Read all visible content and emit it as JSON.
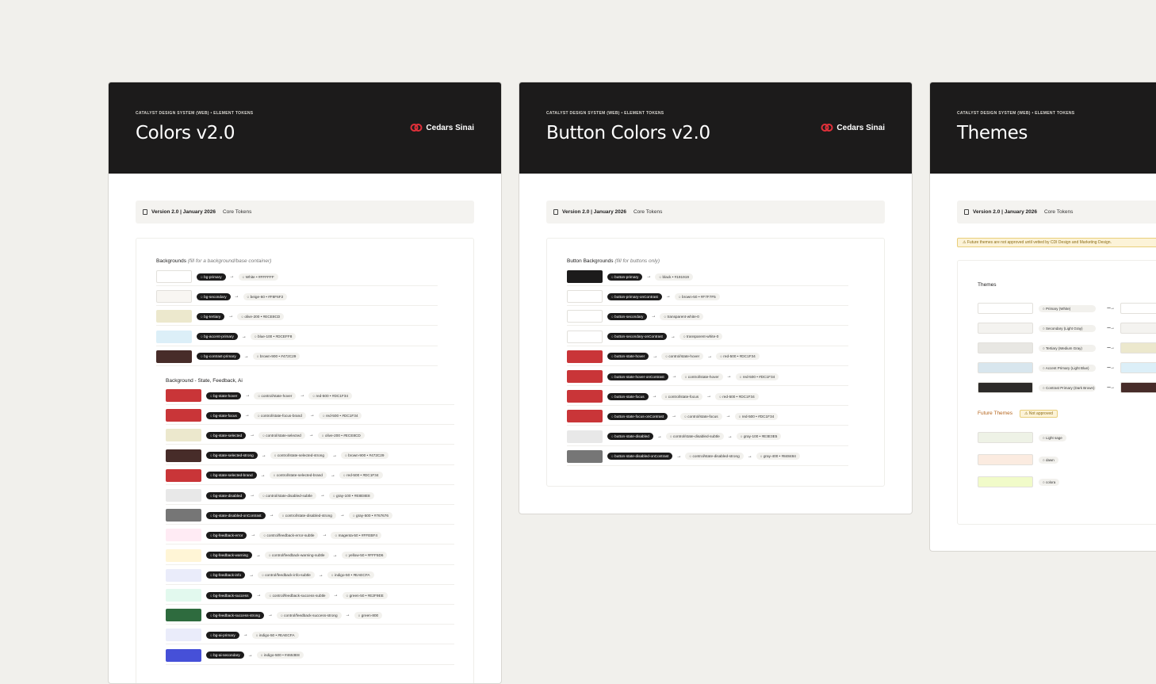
{
  "common": {
    "breadcrumb": "CATALYST DESIGN SYSTEM (WEB) • ELEMENT TOKENS",
    "logo_text": "Cedars Sinai",
    "version": "Version 2.0 | January 2026",
    "core_tokens": "Core Tokens",
    "arrow": "→"
  },
  "colors": {
    "title": "Colors v2.0",
    "backgrounds_title": "Backgrounds",
    "backgrounds_hint": "(fill for a background/base container)",
    "backgrounds": [
      {
        "swatch": "#FFFFFF",
        "token": "○ bg-primary",
        "value": "○ White • #FFFFFF"
      },
      {
        "swatch": "#F8F6F2",
        "token": "○ bg-secondary",
        "value": "○ beige-60 • #F8F6F2"
      },
      {
        "swatch": "#ECE8CD",
        "token": "○ bg-tertiary",
        "value": "○ olive-200 • #ECE8CD"
      },
      {
        "swatch": "#DCEFF8",
        "token": "○ bg-accent-primary",
        "value": "○ blue-100 • #DCEFF8"
      },
      {
        "swatch": "#472C29",
        "token": "○ bg-contrast-primary",
        "value": "○ brown-900 • #472C29"
      }
    ],
    "state_title": "Background - State, Feedback, Ai",
    "state": [
      {
        "swatch": "#C93538",
        "token": "○ bg-state-hover",
        "mid": "○ control/state-hover",
        "value": "○ red-500 • #DC1F34"
      },
      {
        "swatch": "#C93538",
        "token": "○ bg-state-focus",
        "mid": "○ control/state-focus-brand",
        "value": "○ red-500 • #DC1F34"
      },
      {
        "swatch": "#ECE8CD",
        "token": "○ bg-state-selected",
        "mid": "○ control/state-selected",
        "value": "○ olive-200 • #ECE8CD"
      },
      {
        "swatch": "#472C29",
        "token": "○ bg-state-selected-strong",
        "mid": "○ control/state-selected-strong",
        "value": "○ brown-900 • #472C29"
      },
      {
        "swatch": "#C93538",
        "token": "○ bg-state-selected-brand",
        "mid": "○ control/state-selected-brand",
        "value": "○ red-500 • #DC1F34"
      },
      {
        "swatch": "#E8E8E8",
        "token": "○ bg-state-disabled",
        "mid": "○ control/state-disabled-subtle",
        "value": "○ gray-100 • #E8E8E8"
      },
      {
        "swatch": "#767676",
        "token": "○ bg-state-disabled-onContrast",
        "mid": "○ control/state-disabled-strong",
        "value": "○ gray-500 • #767676"
      },
      {
        "swatch": "#FFEBF4",
        "token": "○ bg-feedback-error",
        "mid": "○ control/feedback-error-subtle",
        "value": "○ magenta-50 • #FFEBF4"
      },
      {
        "swatch": "#FFF5D6",
        "token": "○ bg-feedback-warning",
        "mid": "○ control/feedback-warning-subtle",
        "value": "○ yellow-50 • #FFF5D6"
      },
      {
        "swatch": "#EAECFA",
        "token": "○ bg-feedback-info",
        "mid": "○ control/feedback-info-subtle",
        "value": "○ indigo-50 • #EAECFA"
      },
      {
        "swatch": "#E2F9EE",
        "token": "○ bg-feedback-success",
        "mid": "○ control/feedback-success-subtle",
        "value": "○ green-50 • #E2F9EE"
      },
      {
        "swatch": "#2E6B3E",
        "token": "○ bg-feedback-success-strong",
        "mid": "○ control/feedback-success-strong",
        "value": "○ green-800"
      },
      {
        "swatch": "#EAECFA",
        "token": "○ bg-ai-primary",
        "value": "○ indigo-50 • #EAECFA"
      },
      {
        "swatch": "#4650D8",
        "token": "○ bg-ai-secondary",
        "value": "○ indigo-500 • #4653E8"
      }
    ]
  },
  "buttons": {
    "title": "Button Colors v2.0",
    "section_title": "Button Backgrounds",
    "section_hint": "(fill for buttons only)",
    "rows": [
      {
        "swatch": "#1C1B1B",
        "token": "○ button-primary",
        "value": "○ black • #191919"
      },
      {
        "swatch": "#FFFFFF",
        "token": "○ button-primary-onContrast",
        "value": "○ brown-50 • #F7F7F5"
      },
      {
        "swatch": "#FFFFFF",
        "token": "○ button-secondary",
        "value": "○ transparent-white-0"
      },
      {
        "swatch": "#FFFFFF",
        "token": "○ button-secondary-onContrast",
        "value": "○ transparent-white-0"
      },
      {
        "swatch": "#C93538",
        "token": "○ button-state-hover",
        "mid": "○ control/state-hover",
        "value": "○ red-500 • #DC1F34"
      },
      {
        "swatch": "#C93538",
        "token": "○ button-state-hover-onContrast",
        "mid": "○ control/state-hover",
        "value": "○ red-500 • #DC1F34"
      },
      {
        "swatch": "#C93538",
        "token": "○ button-state-focus",
        "mid": "○ control/state-focus",
        "value": "○ red-500 • #DC1F34"
      },
      {
        "swatch": "#C93538",
        "token": "○ button-state-focus-onContrast",
        "mid": "○ control/state-focus",
        "value": "○ red-500 • #DC1F34"
      },
      {
        "swatch": "#E8E8E8",
        "token": "○ button-state-disabled",
        "mid": "○ control/state-disabled-subtle",
        "value": "○ gray-100 • #E3E3E5"
      },
      {
        "swatch": "#767676",
        "token": "○ button-state-disabled-onContrast",
        "mid": "○ control/state-disabled-strong",
        "value": "○ gray-400 • #848484"
      }
    ]
  },
  "themes": {
    "title": "Themes",
    "warning": "⚠ Future themes are not approved until vetted by CDI Design and Marketing Design.",
    "section_title": "Themes",
    "dashed_arrow": "----→",
    "rows": [
      {
        "swatch": "#FFFFFF",
        "label": "○ Primary (White)",
        "target": "#FFFFFF"
      },
      {
        "swatch": "#F4F3F0",
        "label": "○ Secondary (Light Gray)",
        "target": "#F4F3F0"
      },
      {
        "swatch": "#E8E7E3",
        "label": "○ Tertiary (Medium Gray)",
        "target": "#ECE8CD"
      },
      {
        "swatch": "#D8E6EE",
        "label": "○ Accent Primary (Light Blue)",
        "target": "#DCEFF8"
      },
      {
        "swatch": "#2D2B29",
        "label": "○ Contrast Primary (Dark Brown)",
        "target": "#472C29"
      }
    ],
    "future_title": "Future Themes",
    "not_approved": "⚠ Not approved",
    "future": [
      {
        "swatch": "#EEF2E6",
        "label": "○ Light sage"
      },
      {
        "swatch": "#FBEBE0",
        "label": "○ dawn"
      },
      {
        "swatch": "#F1FBC9",
        "label": "○ colora"
      }
    ]
  }
}
